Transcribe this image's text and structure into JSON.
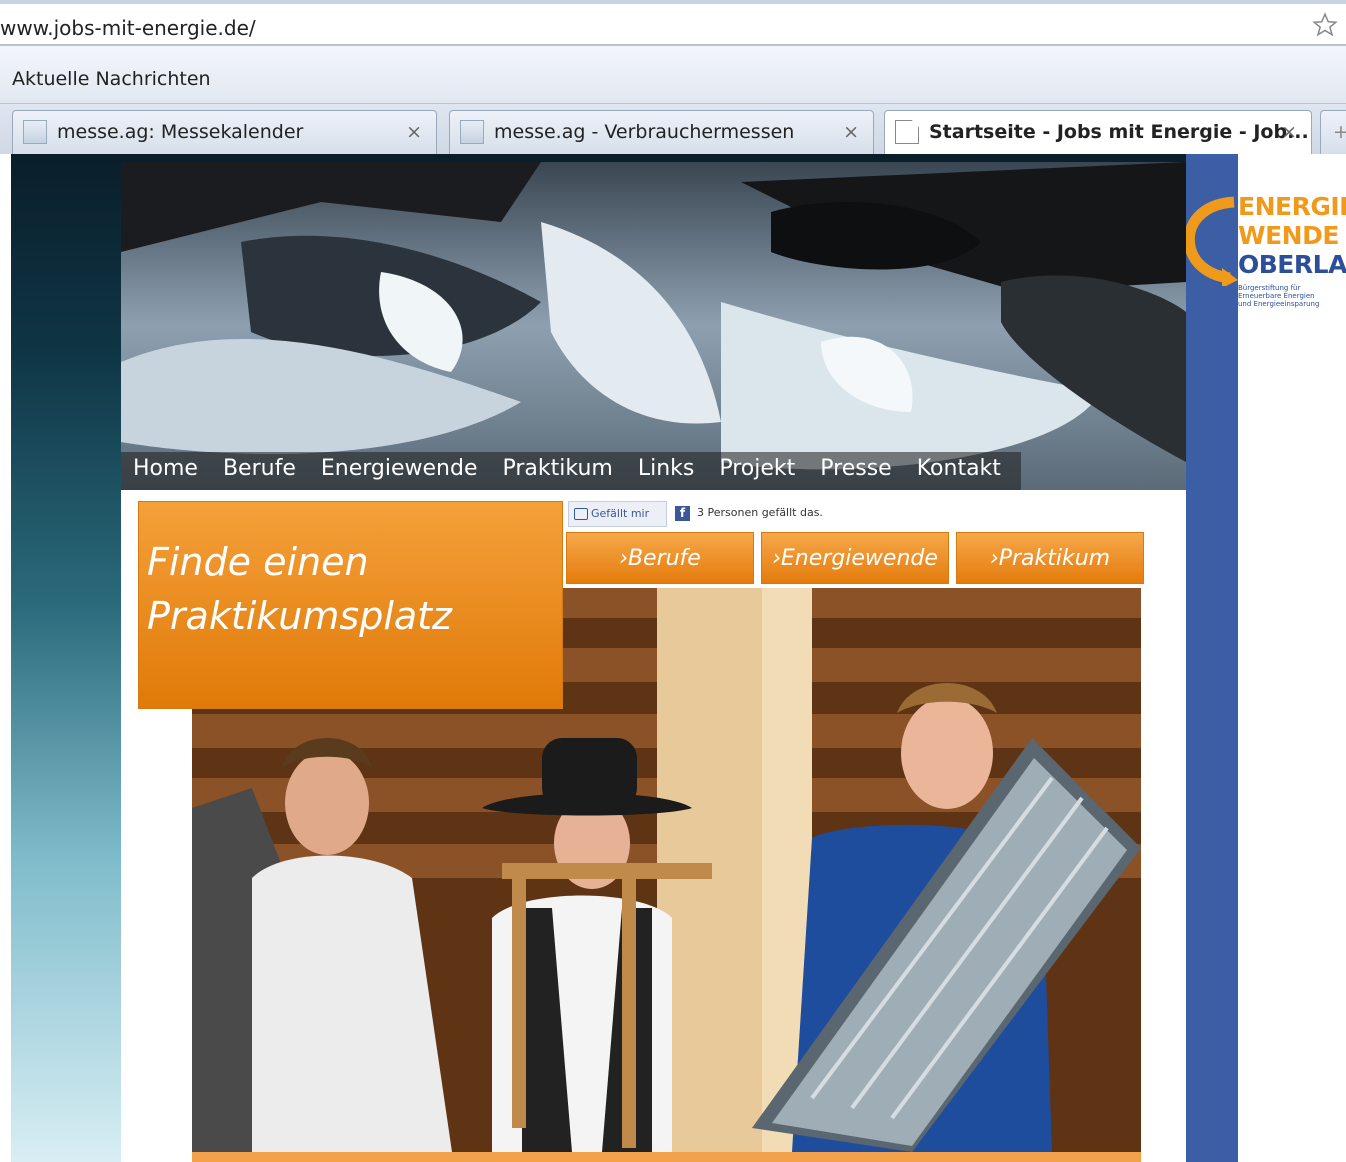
{
  "browser": {
    "url": "www.jobs-mit-energie.de/",
    "bookmark": "Aktuelle Nachrichten",
    "tabs": [
      {
        "title": "messe.ag: Messekalender",
        "close": "×"
      },
      {
        "title": "messe.ag - Verbrauchermessen",
        "close": "×"
      },
      {
        "title": "Startseite - Jobs mit Energie - Job...",
        "close": "×"
      }
    ],
    "new_tab": "+"
  },
  "site": {
    "nav": [
      "Home",
      "Berufe",
      "Energiewende",
      "Praktikum",
      "Links",
      "Projekt",
      "Presse",
      "Kontakt"
    ],
    "promo": {
      "line1": "Finde einen",
      "line2": "Praktikumsplatz"
    },
    "facebook": {
      "like_label": "Gefällt mir",
      "count_text": "3 Personen gefällt das.",
      "icon": "f"
    },
    "buttons": [
      "›Berufe",
      "›Energiewende",
      "›Praktikum"
    ]
  },
  "sidebar_logo": {
    "line1": "ENERGIE",
    "line2": "WENDE",
    "line3": "OBERLAND",
    "sub": "Bürgerstiftung für Erneuerbare Energien und Energieeinsparung"
  },
  "colors": {
    "orange": "#e47c0c",
    "blue": "#3b5ea4",
    "facebook": "#3b5998"
  }
}
